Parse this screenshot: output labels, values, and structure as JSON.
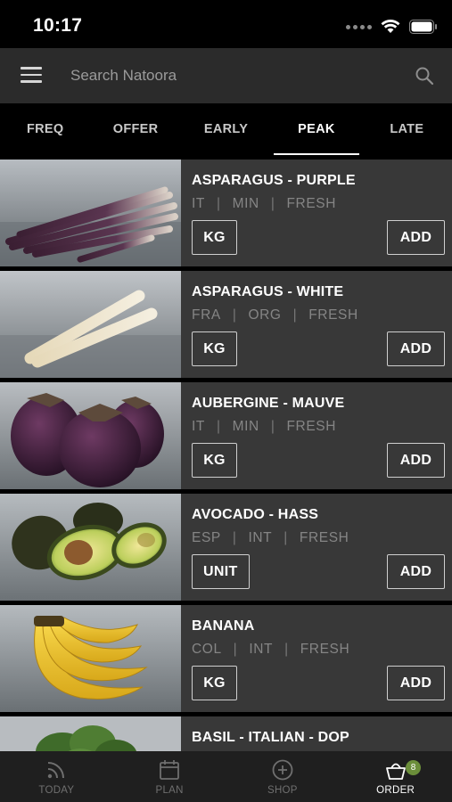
{
  "status_bar": {
    "time": "10:17"
  },
  "search": {
    "placeholder": "Search Natoora"
  },
  "tabs": [
    {
      "label": "FREQ",
      "active": false
    },
    {
      "label": "OFFER",
      "active": false
    },
    {
      "label": "EARLY",
      "active": false
    },
    {
      "label": "PEAK",
      "active": true
    },
    {
      "label": "LATE",
      "active": false
    }
  ],
  "products": [
    {
      "name": "ASPARAGUS - PURPLE",
      "tags": [
        "IT",
        "MIN",
        "FRESH"
      ],
      "unit": "KG",
      "add": "ADD",
      "image": "purple-asparagus"
    },
    {
      "name": "ASPARAGUS - WHITE",
      "tags": [
        "FRA",
        "ORG",
        "FRESH"
      ],
      "unit": "KG",
      "add": "ADD",
      "image": "white-asparagus"
    },
    {
      "name": "AUBERGINE - MAUVE",
      "tags": [
        "IT",
        "MIN",
        "FRESH"
      ],
      "unit": "KG",
      "add": "ADD",
      "image": "aubergine"
    },
    {
      "name": "AVOCADO - HASS",
      "tags": [
        "ESP",
        "INT",
        "FRESH"
      ],
      "unit": "UNIT",
      "add": "ADD",
      "image": "avocado"
    },
    {
      "name": "BANANA",
      "tags": [
        "COL",
        "INT",
        "FRESH"
      ],
      "unit": "KG",
      "add": "ADD",
      "image": "banana"
    },
    {
      "name": "BASIL - ITALIAN - DOP",
      "tags": [],
      "unit": "",
      "add": "",
      "image": "basil"
    }
  ],
  "bottom_nav": [
    {
      "label": "TODAY",
      "icon": "rss-icon",
      "active": false
    },
    {
      "label": "PLAN",
      "icon": "calendar-icon",
      "active": false
    },
    {
      "label": "SHOP",
      "icon": "plus-circle-icon",
      "active": false
    },
    {
      "label": "ORDER",
      "icon": "basket-icon",
      "active": true,
      "badge": "8"
    }
  ],
  "colors": {
    "background": "#000000",
    "row": "#383838",
    "header": "#2b2b2b",
    "badge": "#6b8e3a"
  }
}
